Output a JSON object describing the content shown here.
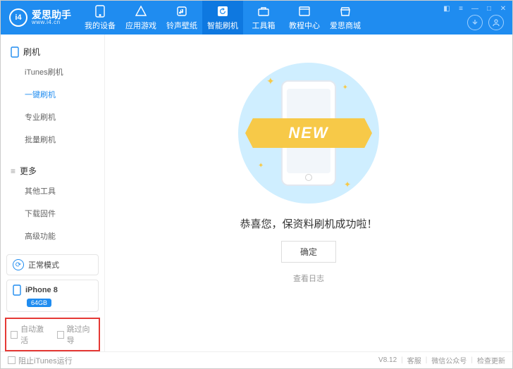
{
  "brand": {
    "logo_text": "i4",
    "name_cn": "爱思助手",
    "name_en": "www.i4.cn"
  },
  "tabs": [
    {
      "label": "我的设备",
      "icon": "phone"
    },
    {
      "label": "应用游戏",
      "icon": "apps"
    },
    {
      "label": "铃声壁纸",
      "icon": "music"
    },
    {
      "label": "智能刷机",
      "icon": "refresh",
      "active": true
    },
    {
      "label": "工具箱",
      "icon": "toolbox"
    },
    {
      "label": "教程中心",
      "icon": "book"
    },
    {
      "label": "爱思商城",
      "icon": "store"
    }
  ],
  "sidebar": {
    "group1": {
      "title": "刷机",
      "items": [
        {
          "label": "iTunes刷机"
        },
        {
          "label": "一键刷机",
          "active": true
        },
        {
          "label": "专业刷机"
        },
        {
          "label": "批量刷机"
        }
      ]
    },
    "group2": {
      "title": "更多",
      "items": [
        {
          "label": "其他工具"
        },
        {
          "label": "下载固件"
        },
        {
          "label": "高级功能"
        }
      ]
    },
    "mode": "正常模式",
    "device": {
      "name": "iPhone 8",
      "storage": "64GB"
    },
    "options": {
      "auto_activate": "自动激活",
      "skip_guide": "跳过向导"
    }
  },
  "main": {
    "ribbon": "NEW",
    "success": "恭喜您，保资料刷机成功啦！",
    "ok": "确定",
    "log": "查看日志"
  },
  "footer": {
    "block_itunes": "阻止iTunes运行",
    "version": "V8.12",
    "support": "客服",
    "wechat": "微信公众号",
    "update": "检查更新"
  }
}
